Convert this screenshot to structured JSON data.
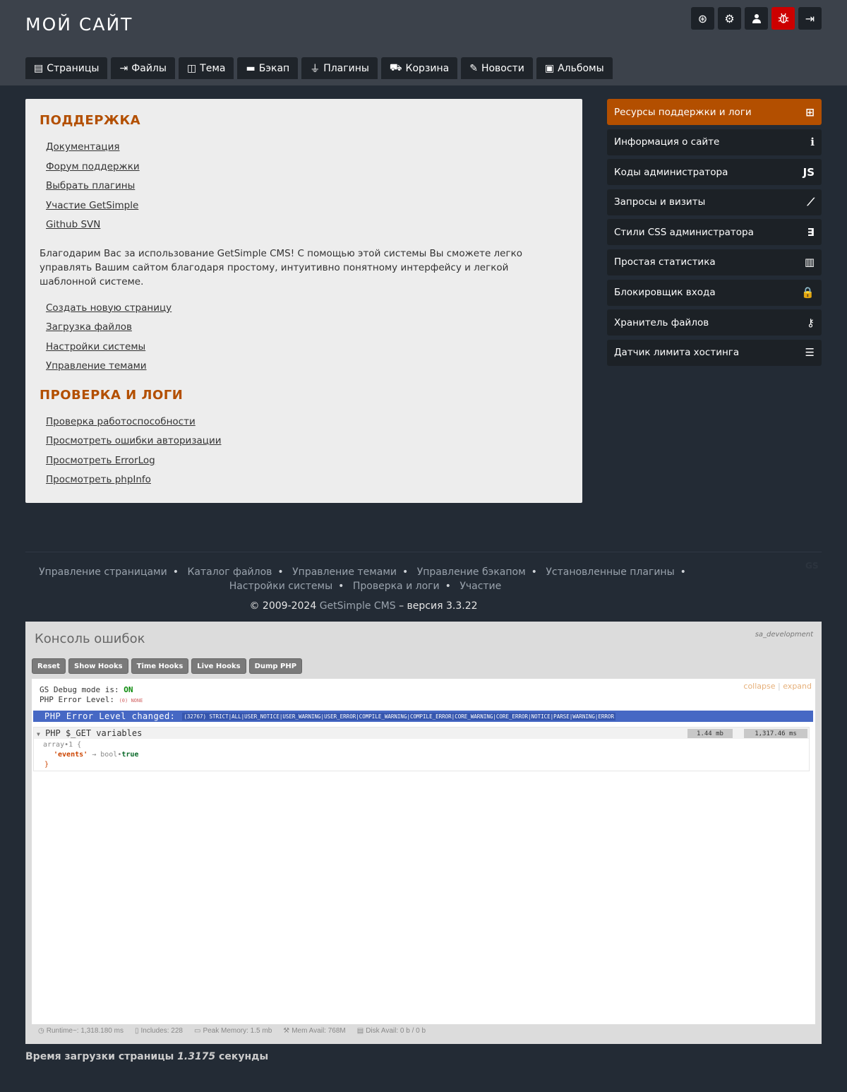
{
  "site": {
    "title": "МОЙ САЙТ"
  },
  "top_icons": [
    "lifebuoy-icon",
    "gear-icon",
    "user-icon",
    "bug-icon",
    "logout-icon"
  ],
  "tabs": [
    {
      "label": "Страницы",
      "icon": "page-icon"
    },
    {
      "label": "Файлы",
      "icon": "upload-icon"
    },
    {
      "label": "Тема",
      "icon": "theme-icon"
    },
    {
      "label": "Бэкап",
      "icon": "backup-icon"
    },
    {
      "label": "Плагины",
      "icon": "plug-icon"
    },
    {
      "label": "Корзина",
      "icon": "cart-icon"
    },
    {
      "label": "Новости",
      "icon": "edit-icon"
    },
    {
      "label": "Альбомы",
      "icon": "image-icon"
    }
  ],
  "support": {
    "heading": "ПОДДЕРЖКА",
    "links1": [
      "Документация",
      "Форум поддержки",
      "Выбрать плагины",
      "Участие GetSimple",
      "Github SVN"
    ],
    "text": "Благодарим Вас за использование GetSimple CMS! С помощью этой системы Вы сможете легко управлять Вашим сайтом благодаря простому, интуитивно понятному интерфейсу и легкой шаблонной системе.",
    "links2": [
      "Создать новую страницу",
      "Загрузка файлов",
      "Настройки системы",
      "Управление темами"
    ],
    "heading2": "ПРОВЕРКА И ЛОГИ",
    "links3": [
      "Проверка работоспособности",
      "Просмотреть ошибки авторизации",
      "Просмотреть ErrorLog",
      "Просмотреть phpInfo"
    ]
  },
  "sidebar": [
    {
      "label": "Ресурсы поддержки и логи",
      "icon": "medkit-icon",
      "glyph": "⊞"
    },
    {
      "label": "Информация о сайте",
      "icon": "info-icon",
      "glyph": "ℹ"
    },
    {
      "label": "Коды администратора",
      "icon": "js-icon",
      "glyph": "JS"
    },
    {
      "label": "Запросы и визиты",
      "icon": "line-chart-icon",
      "glyph": "⟋"
    },
    {
      "label": "Стили CSS администратора",
      "icon": "css3-icon",
      "glyph": "∃"
    },
    {
      "label": "Простая статистика",
      "icon": "bar-chart-icon",
      "glyph": "▥"
    },
    {
      "label": "Блокировщик входа",
      "icon": "lock-icon",
      "glyph": "🔒"
    },
    {
      "label": "Хранитель файлов",
      "icon": "key-icon",
      "glyph": "⚷"
    },
    {
      "label": "Датчик лимита хостинга",
      "icon": "server-icon",
      "glyph": "☰"
    }
  ],
  "footer": {
    "links": [
      "Управление страницами",
      "Каталог файлов",
      "Управление темами",
      "Управление бэкапом",
      "Установленные плагины",
      "Настройки системы",
      "Проверка и логи",
      "Участие"
    ],
    "gs_mark": "GS",
    "copyright_pre": "© 2009-2024",
    "copyright_brand": "GetSimple CMS",
    "copyright_post": "– версия 3.3.22"
  },
  "console": {
    "title": "Консоль ошибок",
    "env": "sa_development",
    "buttons": [
      "Reset",
      "Show Hooks",
      "Time Hooks",
      "Live Hooks",
      "Dump PHP"
    ],
    "collapse": "collapse",
    "expand": "expand",
    "debug_label": "GS Debug mode is:",
    "debug_value": "ON",
    "error_level_label": "PHP Error Level:",
    "error_level_value": "(0) NONE",
    "changed_label": "PHP Error Level changed:",
    "changed_value": "(32767) STRICT|ALL|USER_NOTICE|USER_WARNING|USER_ERROR|COMPILE_WARNING|COMPILE_ERROR|CORE_WARNING|CORE_ERROR|NOTICE|PARSE|WARNING|ERROR",
    "get_title": "PHP $_GET variables",
    "mem_badge": "1.44 mb",
    "time_badge": "1,317.46 ms",
    "array_open": "array•1 {",
    "array_key": "'events'",
    "array_arrow": "→ bool•",
    "array_val": "true",
    "array_close": "}",
    "footer": [
      {
        "icon": "clock-icon",
        "glyph": "◷",
        "text": "Runtime~: 1,318.180 ms"
      },
      {
        "icon": "file-icon",
        "glyph": "▯",
        "text": "Includes: 228"
      },
      {
        "icon": "image-icon",
        "glyph": "▭",
        "text": "Peak Memory: 1.5 mb"
      },
      {
        "icon": "wrench-icon",
        "glyph": "⚒",
        "text": "Mem Avail: 768M"
      },
      {
        "icon": "disk-icon",
        "glyph": "▤",
        "text": "Disk Avail: 0 b / 0 b"
      }
    ]
  },
  "load_time": {
    "pre": "Время загрузки страницы",
    "value": "1.3175",
    "post": "секунды"
  }
}
